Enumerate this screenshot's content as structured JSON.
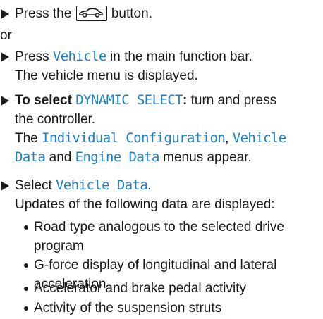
{
  "steps": [
    {
      "prefix": "Press the",
      "suffix": "button."
    },
    {
      "text": "or"
    },
    {
      "prefix": "Press",
      "hl": "Vehicle",
      "suffix": "in the main function bar.",
      "line2": "The vehicle menu is displayed."
    },
    {
      "bold_prefix": "To select",
      "hl": "DYNAMIC SELECT",
      "bold_colon": ":",
      "suffix": "turn and press",
      "line2": "the controller.",
      "line3_prefix": "The",
      "hl_a": "Individual Configuration",
      "comma": ",",
      "hl_b1": "Vehicle",
      "hl_b2": "Data",
      "and": "and",
      "hl_c": "Engine Data",
      "line4_suffix": "menus appear."
    },
    {
      "prefix": "Select",
      "hl": "Vehicle Data",
      "period": ".",
      "line2": "Updates of the following data are displayed:"
    }
  ],
  "bullets": [
    {
      "line1": "Road type analogous to the selected drive",
      "line2": "program"
    },
    {
      "line1": "G-force display of longitudinal and lateral",
      "line2": "acceleration"
    },
    {
      "line1": "Accelerator and brake pedal activity"
    },
    {
      "line1": "Activity of the suspension struts"
    }
  ],
  "icons": {
    "arrow": "triangle-right-icon",
    "button": "car-icon"
  },
  "colors": {
    "text": "#1a1a1a",
    "highlight": "#1d80c6"
  }
}
